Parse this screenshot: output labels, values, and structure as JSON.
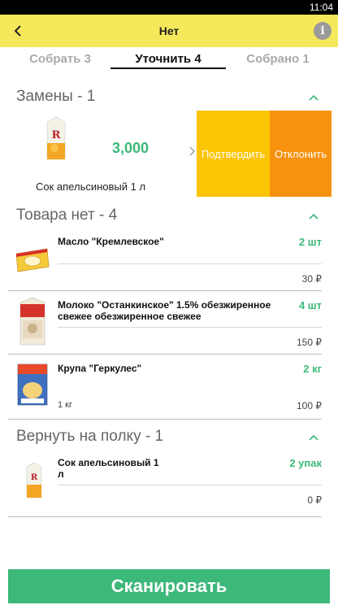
{
  "status_bar": {
    "time": "11:04"
  },
  "app_bar": {
    "title": "Нет",
    "info_glyph": "i"
  },
  "tabs": [
    {
      "label": "Собрать 3"
    },
    {
      "label": "Уточнить 4"
    },
    {
      "label": "Собрано 1"
    }
  ],
  "sections": {
    "replacements": {
      "title": "Замены - 1",
      "item": {
        "name": "Сок апельсиновый 1 л",
        "qty": "3,000",
        "confirm_label": "Подтвердить",
        "reject_label": "Отклонить"
      }
    },
    "no_goods": {
      "title": "Товара нет - 4",
      "items": [
        {
          "name": "Масло \"Кремлевское\"",
          "qty": "2 шт",
          "sub": "",
          "price": "30 ₽"
        },
        {
          "name": "Молоко \"Останкинское\" 1.5% обезжиренное свежее обезжиренное свежее",
          "qty": "4 шт",
          "sub": "",
          "price": "150 ₽"
        },
        {
          "name": "Крупа \"Геркулес\"",
          "qty": "2 кг",
          "sub": "1 кг",
          "price": "100 ₽"
        }
      ]
    },
    "return_shelf": {
      "title": "Вернуть на полку - 1",
      "items": [
        {
          "name": "Сок апельсиновый 1 л",
          "qty": "2 упак",
          "sub": "",
          "price": "0 ₽"
        }
      ]
    }
  },
  "scan_button": {
    "label": "Сканировать"
  },
  "colors": {
    "app_bar": "#f5e85a",
    "accent_green": "#3cb878",
    "confirm": "#fbc404",
    "reject": "#f7920f"
  },
  "icons": [
    "back-arrow-icon",
    "info-icon",
    "chevron-up-icon",
    "chevron-right-icon"
  ]
}
